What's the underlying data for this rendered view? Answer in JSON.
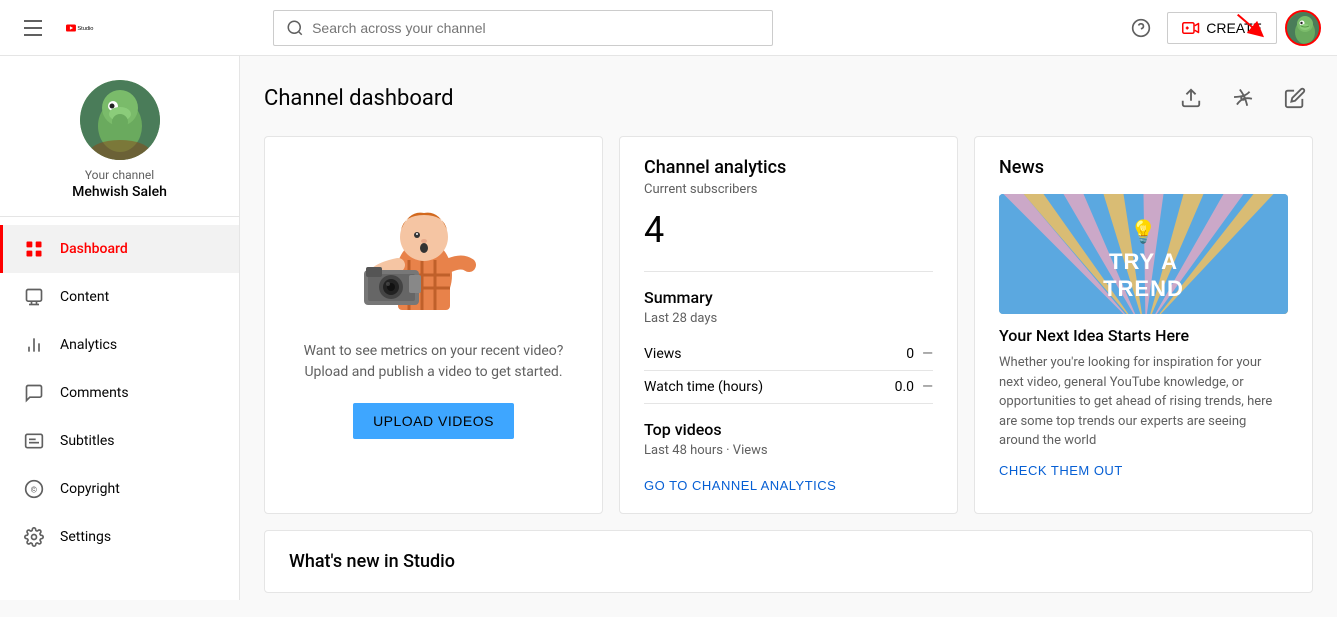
{
  "app": {
    "name": "YouTube Studio",
    "search_placeholder": "Search across your channel"
  },
  "header": {
    "create_label": "CREATE",
    "help_tooltip": "Help"
  },
  "channel": {
    "label": "Your channel",
    "name": "Mehwish Saleh"
  },
  "sidebar": {
    "items": [
      {
        "id": "dashboard",
        "label": "Dashboard",
        "active": true
      },
      {
        "id": "content",
        "label": "Content",
        "active": false
      },
      {
        "id": "analytics",
        "label": "Analytics",
        "active": false
      },
      {
        "id": "comments",
        "label": "Comments",
        "active": false
      },
      {
        "id": "subtitles",
        "label": "Subtitles",
        "active": false
      },
      {
        "id": "copyright",
        "label": "Copyright",
        "active": false
      },
      {
        "id": "settings",
        "label": "Settings",
        "active": false
      }
    ]
  },
  "page": {
    "title": "Channel dashboard"
  },
  "upload_card": {
    "desc": "Want to see metrics on your recent video?\nUpload and publish a video to get started.",
    "button": "UPLOAD VIDEOS"
  },
  "analytics_card": {
    "title": "Channel analytics",
    "subscribers_label": "Current subscribers",
    "subscribers_count": "4",
    "summary_title": "Summary",
    "summary_period": "Last 28 days",
    "metrics": [
      {
        "label": "Views",
        "value": "0"
      },
      {
        "label": "Watch time (hours)",
        "value": "0.0"
      }
    ],
    "top_videos_title": "Top videos",
    "top_videos_period": "Last 48 hours · Views",
    "go_to_analytics": "GO TO CHANNEL ANALYTICS"
  },
  "news_card": {
    "title": "News",
    "image_text_line1": "TRY A",
    "image_text_line2": "TREND",
    "item_title": "Your Next Idea Starts Here",
    "item_desc": "Whether you're looking for inspiration for your next video, general YouTube knowledge, or opportunities to get ahead of rising trends, here are some top trends our experts are seeing around the world",
    "check_out": "CHECK THEM OUT"
  },
  "whats_new_card": {
    "title": "What's new in Studio"
  }
}
